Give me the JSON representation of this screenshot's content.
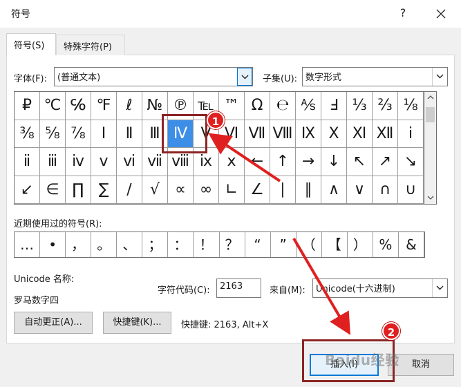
{
  "window": {
    "title": "符号",
    "help_label": "?",
    "close_label": "✕"
  },
  "tabs": [
    {
      "label": "符号(S)"
    },
    {
      "label": "特殊字符(P)"
    }
  ],
  "font": {
    "label": "字体(F):",
    "value": "(普通文本)"
  },
  "subset": {
    "label": "子集(U):",
    "value": "数字形式"
  },
  "symbol_grid": {
    "rows": [
      [
        "₽",
        "℃",
        "℅",
        "℉",
        "ℓ",
        "№",
        "℗",
        "℡",
        "™",
        "Ω",
        "℮",
        "⅍",
        "Ⅎ",
        "⅓",
        "⅔",
        "⅛"
      ],
      [
        "⅜",
        "⅝",
        "⅞",
        "Ⅰ",
        "Ⅱ",
        "Ⅲ",
        "Ⅳ",
        "Ⅴ",
        "Ⅵ",
        "Ⅶ",
        "Ⅷ",
        "Ⅸ",
        "Ⅹ",
        "Ⅺ",
        "Ⅻ",
        "ⅰ"
      ],
      [
        "ⅱ",
        "ⅲ",
        "ⅳ",
        "ⅴ",
        "ⅵ",
        "ⅶ",
        "ⅷ",
        "ⅸ",
        "ⅹ",
        "←",
        "↑",
        "→",
        "↓",
        "↖",
        "↗",
        "↘"
      ],
      [
        "↙",
        "∈",
        "∏",
        "∑",
        "∕",
        "√",
        "∝",
        "∞",
        "∟",
        "∠",
        "∣",
        "∥",
        "∧",
        "∨",
        "∩",
        "∪"
      ]
    ],
    "selected": "Ⅳ"
  },
  "recent": {
    "label": "近期使用过的符号(R):",
    "symbols": [
      "…",
      "•",
      "，",
      "。",
      "、",
      "；",
      "：",
      "！",
      "？",
      "“",
      "”",
      "（",
      "【",
      "）",
      "%",
      "&"
    ]
  },
  "unicode": {
    "name_label": "Unicode 名称:",
    "name_value": "罗马数字四",
    "code_label": "字符代码(C):",
    "code_value": "2163",
    "from_label": "来自(M):",
    "from_value": "Unicode(十六进制)"
  },
  "buttons": {
    "autocorrect": "自动更正(A)...",
    "shortcut_key": "快捷键(K)...",
    "shortcut_info": "快捷键: 2163, Alt+X",
    "insert": "插入(I)",
    "cancel": "取消"
  },
  "annotations": {
    "badge_1": "1",
    "badge_2": "2",
    "watermark": "Baidu经验",
    "arrow_color": "#e02020",
    "box_color": "#8b2424"
  }
}
